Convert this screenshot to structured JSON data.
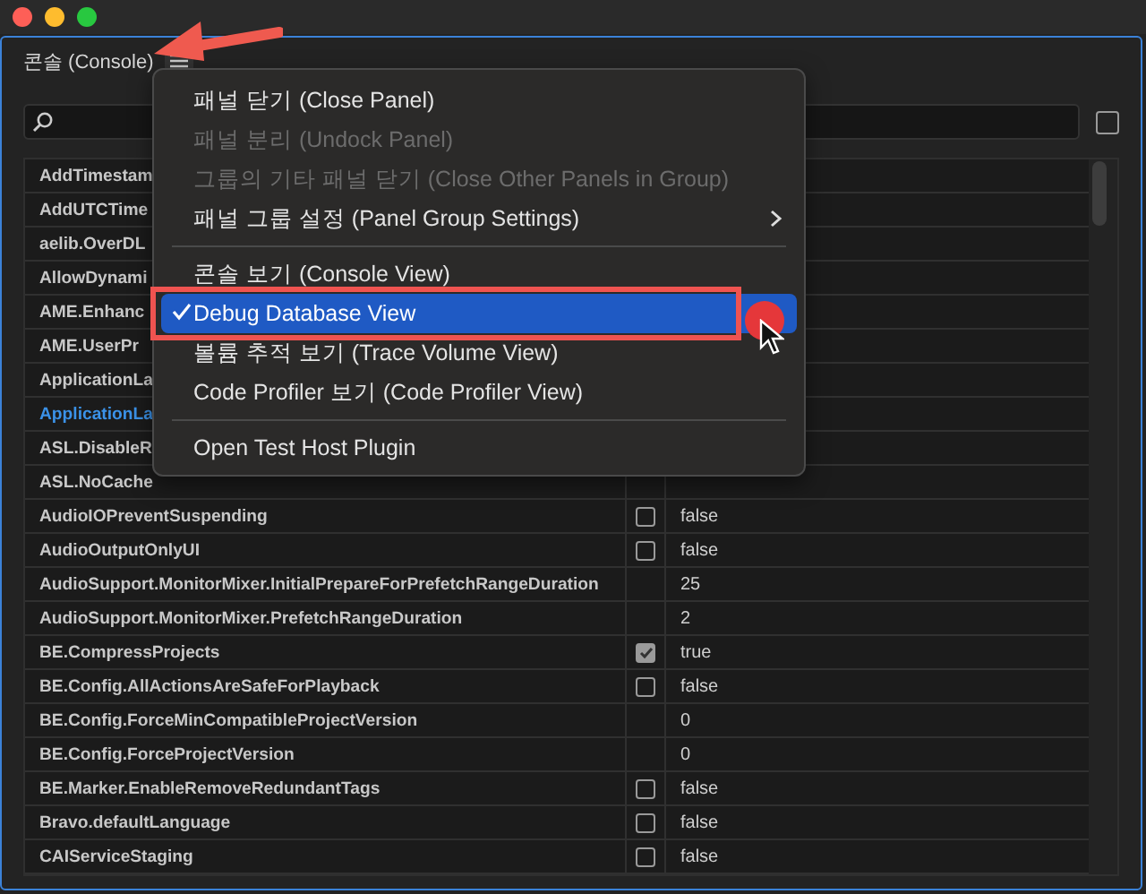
{
  "panel": {
    "title": "콘솔 (Console)"
  },
  "filter_toggle": {
    "checked": false
  },
  "rows": [
    {
      "name": "AddTimestam",
      "selected": false
    },
    {
      "name": "AddUTCTime",
      "selected": false
    },
    {
      "name": "aelib.OverDL",
      "selected": false
    },
    {
      "name": "AllowDynami",
      "selected": false
    },
    {
      "name": "AME.Enhanc",
      "selected": false
    },
    {
      "name": "AME.UserPr",
      "selected": false
    },
    {
      "name": "ApplicationLa",
      "selected": false
    },
    {
      "name": "ApplicationLa",
      "selected": true
    },
    {
      "name": "ASL.DisableR",
      "selected": false
    },
    {
      "name": "ASL.NoCache",
      "selected": false
    },
    {
      "name": "AudioIOPreventSuspending",
      "selected": false,
      "kind": "bool",
      "checked": false,
      "value": "false"
    },
    {
      "name": "AudioOutputOnlyUI",
      "selected": false,
      "kind": "bool",
      "checked": false,
      "value": "false"
    },
    {
      "name": "AudioSupport.MonitorMixer.InitialPrepareForPrefetchRangeDuration",
      "selected": false,
      "kind": "number",
      "value": "25"
    },
    {
      "name": "AudioSupport.MonitorMixer.PrefetchRangeDuration",
      "selected": false,
      "kind": "number",
      "value": "2"
    },
    {
      "name": "BE.CompressProjects",
      "selected": false,
      "kind": "bool",
      "checked": true,
      "value": "true"
    },
    {
      "name": "BE.Config.AllActionsAreSafeForPlayback",
      "selected": false,
      "kind": "bool",
      "checked": false,
      "value": "false"
    },
    {
      "name": "BE.Config.ForceMinCompatibleProjectVersion",
      "selected": false,
      "kind": "number",
      "value": "0"
    },
    {
      "name": "BE.Config.ForceProjectVersion",
      "selected": false,
      "kind": "number",
      "value": "0"
    },
    {
      "name": "BE.Marker.EnableRemoveRedundantTags",
      "selected": false,
      "kind": "bool",
      "checked": false,
      "value": "false"
    },
    {
      "name": "Bravo.defaultLanguage",
      "selected": false,
      "kind": "bool",
      "checked": false,
      "value": "false"
    },
    {
      "name": "CAIServiceStaging",
      "selected": false,
      "kind": "bool",
      "checked": false,
      "value": "false"
    }
  ],
  "menu": [
    {
      "kind": "item",
      "label": "패널 닫기 (Close Panel)",
      "disabled": false,
      "checked": false,
      "highlighted": false,
      "submenu": false
    },
    {
      "kind": "item",
      "label": "패널 분리 (Undock Panel)",
      "disabled": true,
      "checked": false,
      "highlighted": false,
      "submenu": false
    },
    {
      "kind": "item",
      "label": "그룹의 기타 패널 닫기 (Close Other Panels in Group)",
      "disabled": true,
      "checked": false,
      "highlighted": false,
      "submenu": false
    },
    {
      "kind": "item",
      "label": "패널 그룹 설정 (Panel Group Settings)",
      "disabled": false,
      "checked": false,
      "highlighted": false,
      "submenu": true
    },
    {
      "kind": "separator"
    },
    {
      "kind": "item",
      "label": "콘솔 보기 (Console View)",
      "disabled": false,
      "checked": false,
      "highlighted": false,
      "submenu": false
    },
    {
      "kind": "item",
      "label": "Debug Database View",
      "disabled": false,
      "checked": true,
      "highlighted": true,
      "submenu": false
    },
    {
      "kind": "item",
      "label": "볼륨 추적 보기 (Trace Volume View)",
      "disabled": false,
      "checked": false,
      "highlighted": false,
      "submenu": false
    },
    {
      "kind": "item",
      "label": "Code Profiler 보기 (Code Profiler View)",
      "disabled": false,
      "checked": false,
      "highlighted": false,
      "submenu": false
    },
    {
      "kind": "separator"
    },
    {
      "kind": "item",
      "label": "Open Test Host Plugin",
      "disabled": false,
      "checked": false,
      "highlighted": false,
      "submenu": false
    }
  ]
}
